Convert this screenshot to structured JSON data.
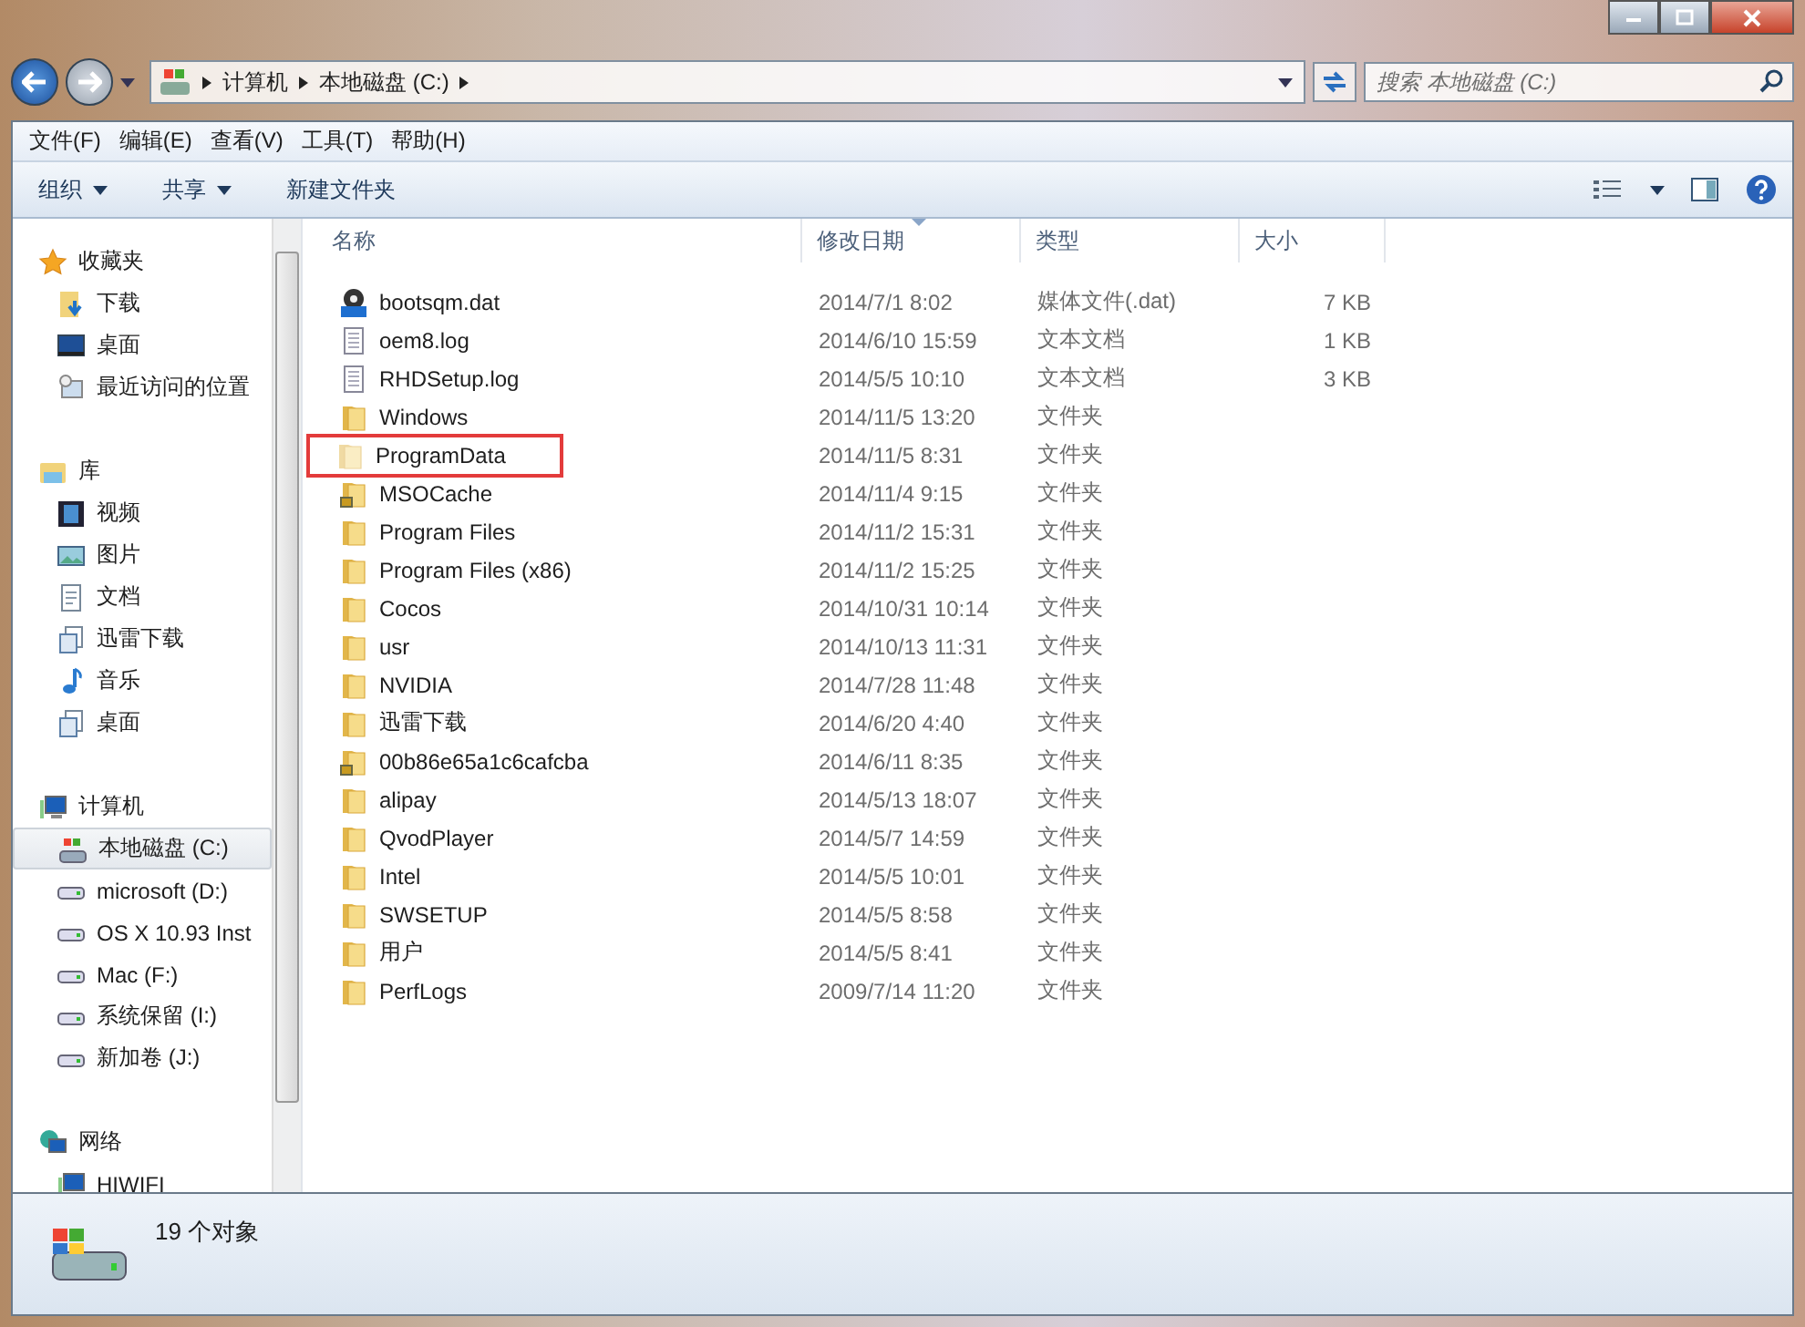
{
  "address": {
    "crumbs": [
      "计算机",
      "本地磁盘 (C:)"
    ]
  },
  "search": {
    "placeholder": "搜索 本地磁盘 (C:)"
  },
  "menu": [
    "文件(F)",
    "编辑(E)",
    "查看(V)",
    "工具(T)",
    "帮助(H)"
  ],
  "toolbar": [
    {
      "label": "组织",
      "dropdown": true
    },
    {
      "label": "共享",
      "dropdown": true
    },
    {
      "label": "新建文件夹",
      "dropdown": false
    }
  ],
  "sidebar": {
    "groups": [
      {
        "label": "收藏夹",
        "kind": "star",
        "children": [
          {
            "label": "下载",
            "kind": "download",
            "selected": false
          },
          {
            "label": "桌面",
            "kind": "desktop",
            "selected": false
          },
          {
            "label": "最近访问的位置",
            "kind": "recent",
            "selected": false
          }
        ]
      },
      {
        "label": "库",
        "kind": "library",
        "children": [
          {
            "label": "视频",
            "kind": "video",
            "selected": false
          },
          {
            "label": "图片",
            "kind": "picture",
            "selected": false
          },
          {
            "label": "文档",
            "kind": "doc",
            "selected": false
          },
          {
            "label": "迅雷下载",
            "kind": "lib",
            "selected": false
          },
          {
            "label": "音乐",
            "kind": "music",
            "selected": false
          },
          {
            "label": "桌面",
            "kind": "lib",
            "selected": false
          }
        ]
      },
      {
        "label": "计算机",
        "kind": "computer",
        "children": [
          {
            "label": "本地磁盘 (C:)",
            "kind": "sysdrive",
            "selected": true
          },
          {
            "label": "microsoft (D:)",
            "kind": "drive",
            "selected": false
          },
          {
            "label": "OS X 10.93 Inst",
            "kind": "drive",
            "selected": false
          },
          {
            "label": "Mac (F:)",
            "kind": "drive",
            "selected": false
          },
          {
            "label": "系统保留 (I:)",
            "kind": "drive",
            "selected": false
          },
          {
            "label": "新加卷 (J:)",
            "kind": "drive",
            "selected": false
          }
        ]
      },
      {
        "label": "网络",
        "kind": "network",
        "children": [
          {
            "label": "HIWIFI",
            "kind": "pc",
            "selected": false
          }
        ]
      }
    ]
  },
  "table": {
    "columns": [
      {
        "label": "名称",
        "sorted": false
      },
      {
        "label": "修改日期",
        "sorted": true
      },
      {
        "label": "类型",
        "sorted": false
      },
      {
        "label": "大小",
        "sorted": false
      }
    ],
    "rows": [
      {
        "kind": "media",
        "name": "bootsqm.dat",
        "date": "2014/7/1 8:02",
        "type": "媒体文件(.dat)",
        "size": "7 KB",
        "highlighted": false
      },
      {
        "kind": "text",
        "name": "oem8.log",
        "date": "2014/6/10 15:59",
        "type": "文本文档",
        "size": "1 KB",
        "highlighted": false
      },
      {
        "kind": "text",
        "name": "RHDSetup.log",
        "date": "2014/5/5 10:10",
        "type": "文本文档",
        "size": "3 KB",
        "highlighted": false
      },
      {
        "kind": "folder",
        "name": "Windows",
        "date": "2014/11/5 13:20",
        "type": "文件夹",
        "highlighted": false
      },
      {
        "kind": "hidden-folder",
        "name": "ProgramData",
        "date": "2014/11/5 8:31",
        "type": "文件夹",
        "highlighted": true
      },
      {
        "kind": "locked-folder",
        "name": "MSOCache",
        "date": "2014/11/4 9:15",
        "type": "文件夹",
        "highlighted": false
      },
      {
        "kind": "folder",
        "name": "Program Files",
        "date": "2014/11/2 15:31",
        "type": "文件夹",
        "highlighted": false
      },
      {
        "kind": "folder",
        "name": "Program Files (x86)",
        "date": "2014/11/2 15:25",
        "type": "文件夹",
        "highlighted": false
      },
      {
        "kind": "folder",
        "name": "Cocos",
        "date": "2014/10/31 10:14",
        "type": "文件夹",
        "highlighted": false
      },
      {
        "kind": "folder",
        "name": "usr",
        "date": "2014/10/13 11:31",
        "type": "文件夹",
        "highlighted": false
      },
      {
        "kind": "folder",
        "name": "NVIDIA",
        "date": "2014/7/28 11:48",
        "type": "文件夹",
        "highlighted": false
      },
      {
        "kind": "folder",
        "name": "迅雷下载",
        "date": "2014/6/20 4:40",
        "type": "文件夹",
        "highlighted": false
      },
      {
        "kind": "locked-folder",
        "name": "00b86e65a1c6cafcba",
        "date": "2014/6/11 8:35",
        "type": "文件夹",
        "highlighted": false
      },
      {
        "kind": "folder",
        "name": "alipay",
        "date": "2014/5/13 18:07",
        "type": "文件夹",
        "highlighted": false
      },
      {
        "kind": "folder",
        "name": "QvodPlayer",
        "date": "2014/5/7 14:59",
        "type": "文件夹",
        "highlighted": false
      },
      {
        "kind": "folder",
        "name": "Intel",
        "date": "2014/5/5 10:01",
        "type": "文件夹",
        "highlighted": false
      },
      {
        "kind": "folder",
        "name": "SWSETUP",
        "date": "2014/5/5 8:58",
        "type": "文件夹",
        "highlighted": false
      },
      {
        "kind": "folder",
        "name": "用户",
        "date": "2014/5/5 8:41",
        "type": "文件夹",
        "highlighted": false
      },
      {
        "kind": "folder",
        "name": "PerfLogs",
        "date": "2009/7/14 11:20",
        "type": "文件夹",
        "highlighted": false
      }
    ]
  },
  "status_bar": {
    "count": "19 个对象"
  }
}
